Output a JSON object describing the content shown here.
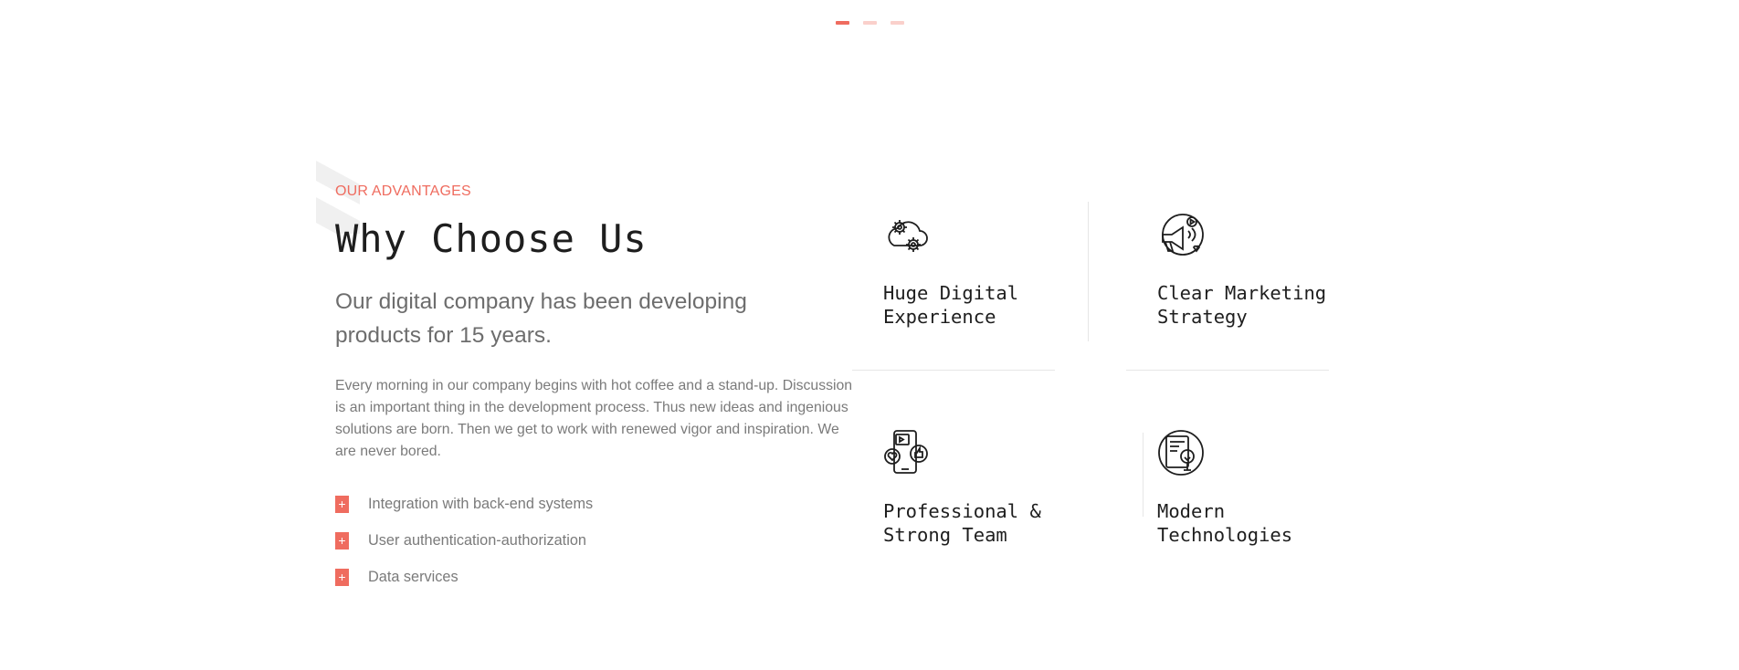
{
  "slider": {
    "dots": 3,
    "active": 0
  },
  "section": {
    "eyebrow": "OUR ADVANTAGES",
    "title": "Why Choose Us",
    "lead": "Our digital company has been developing products for 15 years.",
    "body": "Every morning in our company begins with hot coffee and a stand-up. Discussion is an important thing in the development process. Thus new ideas and ingenious solutions are born. Then we get to work with renewed vigor and inspiration. We are never bored.",
    "features": [
      {
        "icon": "plus-icon",
        "label": "Integration with back-end systems"
      },
      {
        "icon": "plus-icon",
        "label": "User authentication-authorization"
      },
      {
        "icon": "plus-icon",
        "label": "Data services"
      }
    ]
  },
  "advantages": [
    {
      "icon": "gears-cloud-icon",
      "title": "Huge Digital\nExperience"
    },
    {
      "icon": "marketing-megaphone-icon",
      "title": "Clear Marketing\nStrategy"
    },
    {
      "icon": "mobile-social-icon",
      "title": "Professional &\nStrong Team"
    },
    {
      "icon": "tech-tree-device-icon",
      "title": "Modern\nTechnologies"
    }
  ],
  "colors": {
    "accent": "#ef6c5f",
    "heading": "#1e1e1e",
    "text": "#7a7a7a",
    "divider": "#e6e6e6"
  }
}
